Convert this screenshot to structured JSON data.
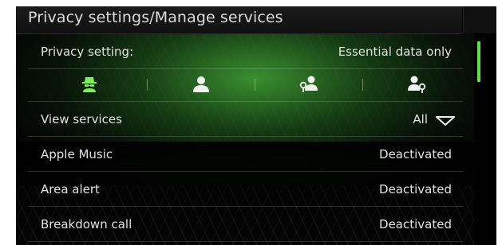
{
  "header": {
    "title": "Privacy settings/Manage services"
  },
  "privacy": {
    "label": "Privacy setting:",
    "value": "Essential data only"
  },
  "tabs": [
    {
      "icon": "incognito-icon",
      "active": true
    },
    {
      "icon": "user-icon",
      "active": false
    },
    {
      "icon": "user-location-icon",
      "active": false
    },
    {
      "icon": "user-location-shared-icon",
      "active": false
    }
  ],
  "view_services": {
    "label": "View services",
    "value": "All"
  },
  "services": [
    {
      "name": "Apple Music",
      "status": "Deactivated"
    },
    {
      "name": "Area alert",
      "status": "Deactivated"
    },
    {
      "name": "Breakdown call",
      "status": "Deactivated"
    }
  ],
  "colors": {
    "accent": "#5fe046",
    "active_icon": "#7ef05a",
    "text": "#e2e2e2"
  }
}
